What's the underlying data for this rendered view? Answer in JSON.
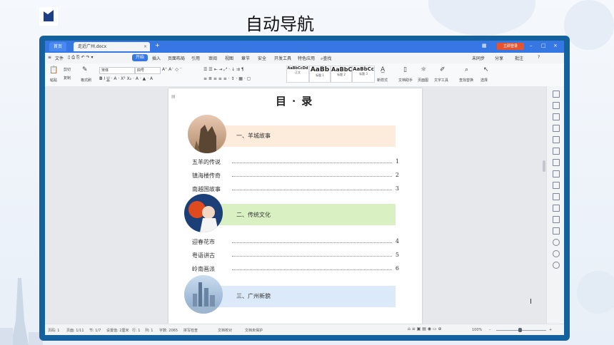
{
  "slide": {
    "title": "自动导航"
  },
  "window": {
    "home_tab": "首页",
    "doc_tab": "走近广州.docx",
    "login_label": "立即登录",
    "menu": [
      "文件",
      "开始",
      "插入",
      "页面布局",
      "引用",
      "审阅",
      "视图",
      "章节",
      "安全",
      "开发工具",
      "特色应用",
      "查找"
    ],
    "right_menu": [
      "未同步",
      "分享",
      "批注"
    ],
    "active_menu_index": 1
  },
  "ribbon": {
    "paste": "粘贴",
    "cut": "剪切",
    "copy": "复制",
    "format_painter": "格式刷",
    "font_name": "宋体",
    "font_size": "四号",
    "styles": [
      {
        "sample": "AaBbCcDd",
        "name": "正文"
      },
      {
        "sample": "AaBb",
        "name": "标题 1"
      },
      {
        "sample": "AaBbC",
        "name": "标题 2"
      },
      {
        "sample": "AaBbCc",
        "name": "标题 3"
      }
    ],
    "new_style": "新样式",
    "text_assistant": "文档助手",
    "text_tools": "文字工具",
    "find_replace": "查找替换",
    "select": "选择",
    "ribbon_extra": "页面图"
  },
  "document": {
    "toc_title": "目·录",
    "sections": [
      {
        "heading": "一、羊城故事",
        "band_color": "#fdebdc",
        "entries": [
          {
            "text": "五羊的传说",
            "page": "1"
          },
          {
            "text": "镇海楼传奇",
            "page": "2"
          },
          {
            "text": "南越国故事",
            "page": "3"
          }
        ]
      },
      {
        "heading": "二、传统文化",
        "band_color": "#d9f0c3",
        "entries": [
          {
            "text": "迎春花市",
            "page": "4"
          },
          {
            "text": "粤语讲古",
            "page": "5"
          },
          {
            "text": "岭南画派",
            "page": "6"
          }
        ]
      },
      {
        "heading": "三、广州新貌",
        "band_color": "#dbe9f8",
        "entries": []
      }
    ]
  },
  "status": {
    "page_num": "页码: 1",
    "pages": "页面: 1/11",
    "section": "节: 1/7",
    "settings": "设置值: 2厘米",
    "row": "行: 1",
    "col": "列: 1",
    "words": "字数: 2065",
    "spell": "拼写检查",
    "doc_check": "文档校对",
    "unprotected": "文档未保护",
    "zoom": "100%"
  },
  "colors": {
    "accent": "#3677e3",
    "frame": "#13629e",
    "login": "#e4542f"
  }
}
